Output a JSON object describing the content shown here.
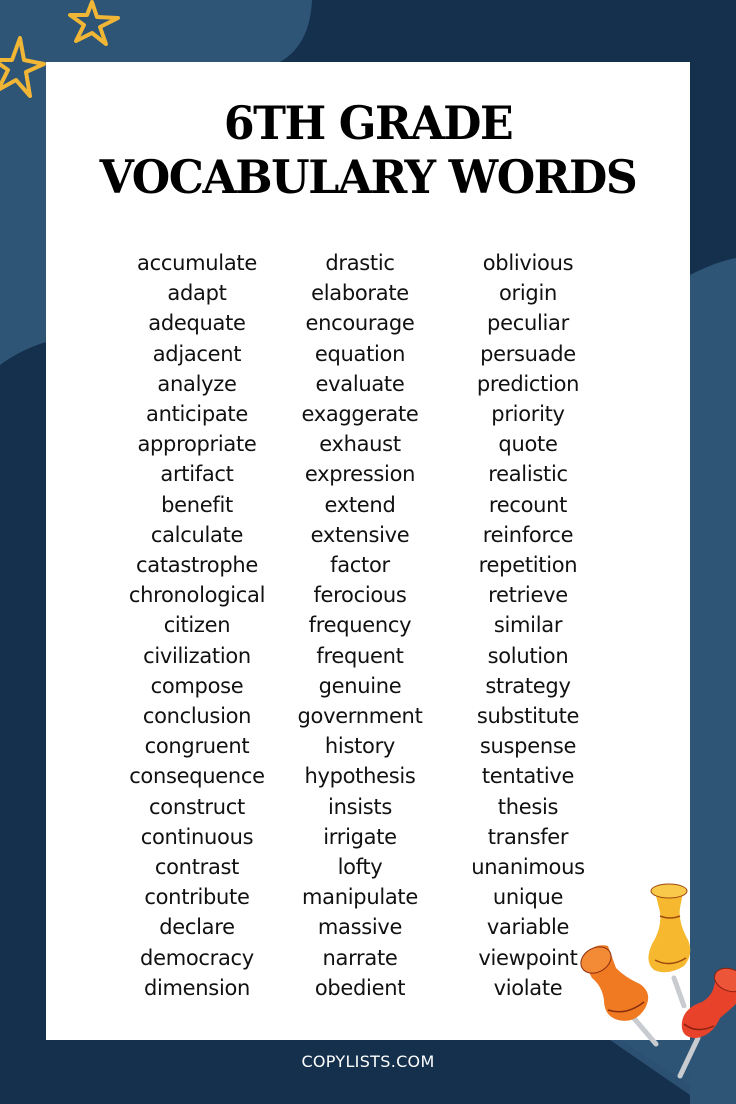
{
  "title": {
    "line1": "6TH GRADE",
    "line2": "VOCABULARY WORDS"
  },
  "columns": [
    [
      "accumulate",
      "adapt",
      "adequate",
      "adjacent",
      "analyze",
      "anticipate",
      "appropriate",
      "artifact",
      "benefit",
      "calculate",
      "catastrophe",
      "chronological",
      "citizen",
      "civilization",
      "compose",
      "conclusion",
      "congruent",
      "consequence",
      "construct",
      "continuous",
      "contrast",
      "contribute",
      "declare",
      "democracy",
      "dimension"
    ],
    [
      "drastic",
      "elaborate",
      "encourage",
      "equation",
      "evaluate",
      "exaggerate",
      "exhaust",
      "expression",
      "extend",
      "extensive",
      "factor",
      "ferocious",
      "frequency",
      "frequent",
      "genuine",
      "government",
      "history",
      "hypothesis",
      "insists",
      "irrigate",
      "lofty",
      "manipulate",
      "massive",
      "narrate",
      "obedient"
    ],
    [
      "oblivious",
      "origin",
      "peculiar",
      "persuade",
      "prediction",
      "priority",
      "quote",
      "realistic",
      "recount",
      "reinforce",
      "repetition",
      "retrieve",
      "similar",
      "solution",
      "strategy",
      "substitute",
      "suspense",
      "tentative",
      "thesis",
      "transfer",
      "unanimous",
      "unique",
      "variable",
      "viewpoint",
      "violate"
    ]
  ],
  "footer": {
    "site": "COPYLISTS.COM"
  },
  "colors": {
    "background_dark": "#14304d",
    "background_light": "#2e5476",
    "card": "#ffffff",
    "star": "#f2b636",
    "pin_yellow": "#f5b82e",
    "pin_orange": "#f07a22",
    "pin_red": "#e8432a"
  }
}
